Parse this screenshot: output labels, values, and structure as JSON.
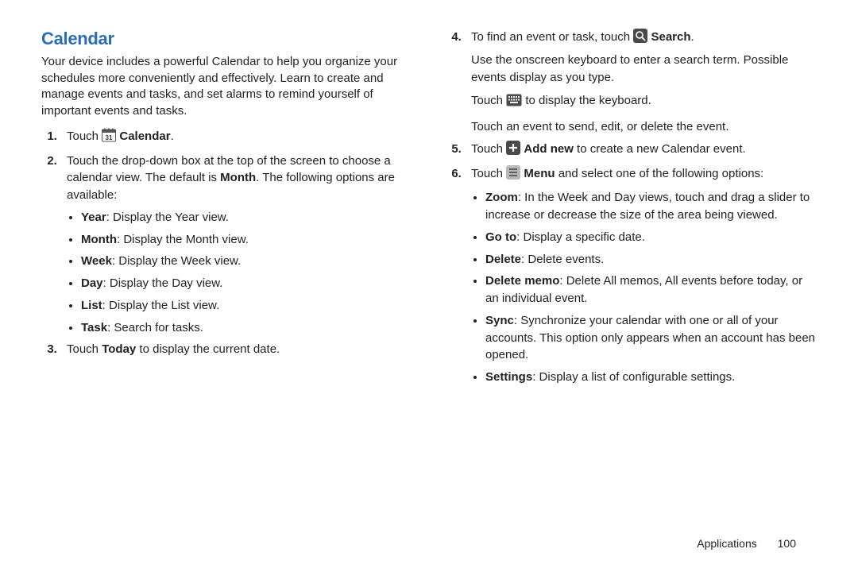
{
  "title": "Calendar",
  "intro": "Your device includes a powerful Calendar to help you organize your schedules more conveniently and effectively. Learn to create and manage events and tasks, and set alarms to remind yourself of important events and tasks.",
  "left": {
    "step1_touch": "Touch",
    "step1_label": "Calendar",
    "step2_part1": "Touch the drop-down box at the top of the screen to choose a calendar view. The default is ",
    "step2_month": "Month",
    "step2_part2": ". The following options are available:",
    "viewlist": [
      {
        "name": "Year",
        "desc": ": Display the Year view."
      },
      {
        "name": "Month",
        "desc": ": Display the Month view."
      },
      {
        "name": "Week",
        "desc": ": Display the Week view."
      },
      {
        "name": "Day",
        "desc": ": Display the Day view."
      },
      {
        "name": "List",
        "desc": ": Display the List view."
      },
      {
        "name": "Task",
        "desc": ": Search for tasks."
      }
    ],
    "step3_a": "Touch ",
    "step3_today": "Today",
    "step3_b": " to display the current date."
  },
  "right": {
    "step4_a": "To find an event or task, touch ",
    "step4_search": "Search",
    "step4_b": ".",
    "step4_p2": "Use the onscreen keyboard to enter a search term. Possible events display as you type.",
    "step4_p3a": "Touch ",
    "step4_p3b": " to display the keyboard.",
    "step4_p4": "Touch an event to send, edit, or delete the event.",
    "step5_a": "Touch ",
    "step5_add": "Add new",
    "step5_b": " to create a new Calendar event.",
    "step6_a": "Touch ",
    "step6_menu": "Menu",
    "step6_b": " and select one of the following options:",
    "menulist": [
      {
        "name": "Zoom",
        "desc": ": In the Week and Day views, touch and drag a slider to increase or decrease the size of the area being viewed."
      },
      {
        "name": "Go to",
        "desc": ": Display a specific date."
      },
      {
        "name": "Delete",
        "desc": ": Delete events."
      },
      {
        "name": "Delete memo",
        "desc": ": Delete All memos, All events before today, or an individual event."
      },
      {
        "name": "Sync",
        "desc": ": Synchronize your calendar with one or all of your accounts. This option only appears when an account has been opened."
      },
      {
        "name": "Settings",
        "desc": ": Display a list of configurable settings."
      }
    ]
  },
  "footer": {
    "section": "Applications",
    "page": "100"
  },
  "icons": {
    "calendar": "calendar-31-icon",
    "search": "search-icon",
    "keyboard": "keyboard-icon",
    "plus": "plus-icon",
    "menu": "menu-icon"
  }
}
